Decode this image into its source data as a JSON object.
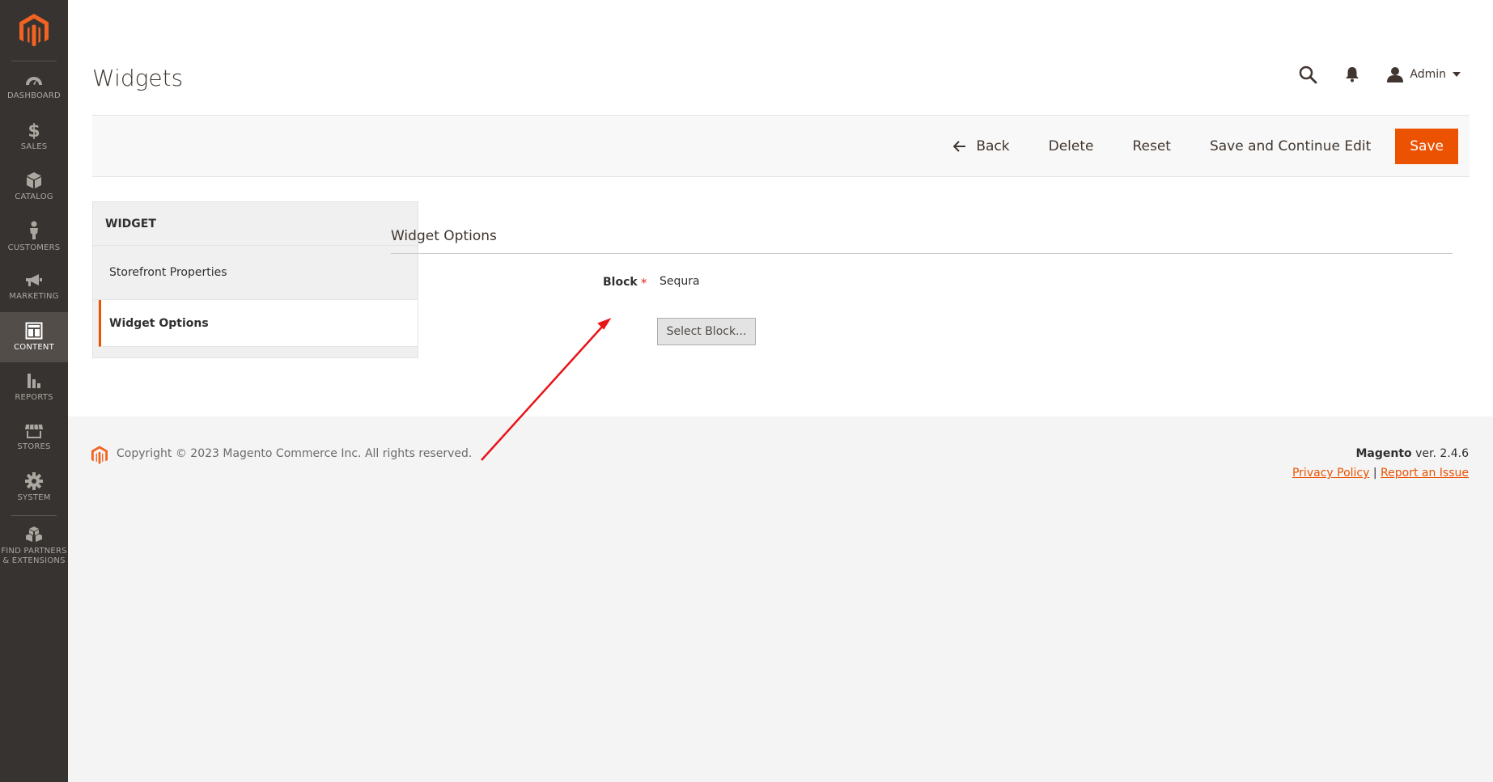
{
  "sidebar": {
    "items": [
      {
        "label": "DASHBOARD",
        "icon": "dashboard-icon"
      },
      {
        "label": "SALES",
        "icon": "dollar-icon"
      },
      {
        "label": "CATALOG",
        "icon": "box-icon"
      },
      {
        "label": "CUSTOMERS",
        "icon": "person-icon"
      },
      {
        "label": "MARKETING",
        "icon": "megaphone-icon"
      },
      {
        "label": "CONTENT",
        "icon": "layout-icon"
      },
      {
        "label": "REPORTS",
        "icon": "bar-chart-icon"
      },
      {
        "label": "STORES",
        "icon": "storefront-icon"
      },
      {
        "label": "SYSTEM",
        "icon": "gear-icon"
      },
      {
        "label": "FIND PARTNERS",
        "label2": "& EXTENSIONS",
        "icon": "cubes-icon"
      }
    ],
    "active": "CONTENT"
  },
  "header": {
    "title": "Widgets",
    "user": "Admin"
  },
  "actions": {
    "back": "Back",
    "delete": "Delete",
    "reset": "Reset",
    "save_continue": "Save and Continue Edit",
    "save": "Save"
  },
  "tabs": {
    "title": "WIDGET",
    "items": [
      "Storefront Properties",
      "Widget Options"
    ],
    "active": "Widget Options"
  },
  "content": {
    "section_title": "Widget Options",
    "block_label": "Block",
    "block_value": "Sequra",
    "select_button": "Select Block..."
  },
  "footer": {
    "copyright": "Copyright © 2023 Magento Commerce Inc. All rights reserved.",
    "brand": "Magento",
    "version": " ver. 2.4.6",
    "privacy": "Privacy Policy",
    "separator": "|",
    "report": "Report an Issue"
  },
  "colors": {
    "accent": "#eb5202",
    "sidebar_bg": "#373330",
    "annotation_arrow": "#e8141a"
  }
}
